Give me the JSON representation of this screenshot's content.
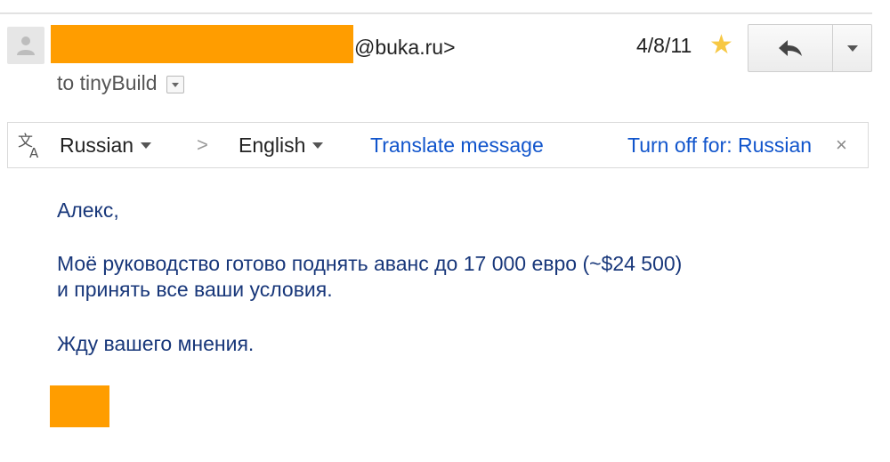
{
  "sender": {
    "email_domain": "@buka.ru>"
  },
  "recipient": {
    "to_text": "to tinyBuild"
  },
  "message": {
    "date": "4/8/11"
  },
  "colors": {
    "redaction": "#ff9d00",
    "link": "#1155cc",
    "body_text": "#18377a",
    "star": "#f7c844"
  },
  "icons": [
    "person-icon",
    "star-icon",
    "reply-icon",
    "dropdown-icon",
    "translate-icon",
    "chevron-right-icon",
    "close-icon"
  ],
  "translate_bar": {
    "from_language": "Russian",
    "arrow": ">",
    "to_language": "English",
    "translate_link": "Translate message",
    "turn_off_link": "Turn off for: Russian",
    "close": "×"
  },
  "body": {
    "greeting": "Алекс,",
    "line1": "Моё руководство готово поднять аванс до 17 000 евро (~$24 500)",
    "line2": "и принять все ваши условия.",
    "line3": "Жду вашего мнения."
  }
}
